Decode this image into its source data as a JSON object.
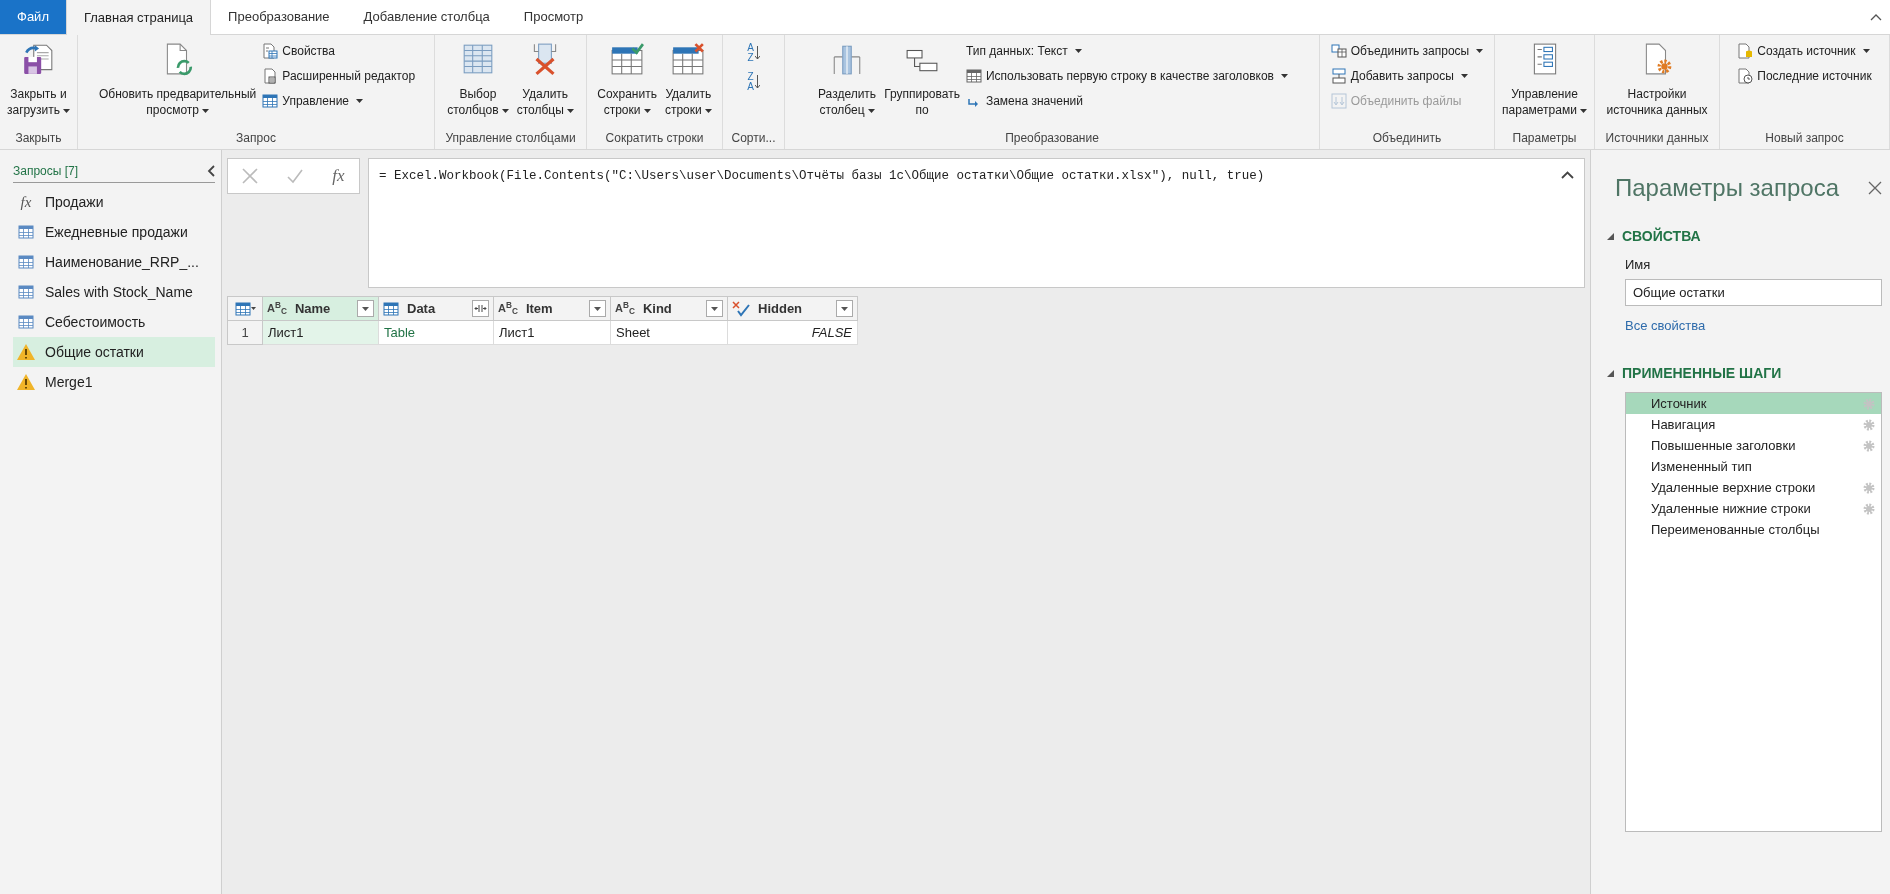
{
  "tabs": [
    {
      "label": "Файл",
      "kind": "file",
      "selected": false
    },
    {
      "label": "Главная страница",
      "kind": "tab",
      "selected": true
    },
    {
      "label": "Преобразование",
      "kind": "tab",
      "selected": false
    },
    {
      "label": "Добавление столбца",
      "kind": "tab",
      "selected": false
    },
    {
      "label": "Просмотр",
      "kind": "tab",
      "selected": false
    }
  ],
  "ribbon": {
    "groups": [
      {
        "label": "Закрыть",
        "items": [
          {
            "kind": "large",
            "lines": [
              "Закрыть и",
              "загрузить"
            ],
            "dropdown": true
          }
        ]
      },
      {
        "label": "Запрос",
        "items": [
          {
            "kind": "large",
            "lines": [
              "Обновить предварительный",
              "просмотр"
            ],
            "dropdown": true
          },
          {
            "kind": "small",
            "label": "Свойства",
            "dropdown": false,
            "disabled": false
          },
          {
            "kind": "small",
            "label": "Расширенный редактор",
            "dropdown": false,
            "disabled": false
          },
          {
            "kind": "small",
            "label": "Управление",
            "dropdown": true,
            "disabled": false
          }
        ]
      },
      {
        "label": "Управление столбцами",
        "items": [
          {
            "kind": "large",
            "lines": [
              "Выбор",
              "столбцов"
            ],
            "dropdown": true
          },
          {
            "kind": "large",
            "lines": [
              "Удалить",
              "столбцы"
            ],
            "dropdown": true
          }
        ]
      },
      {
        "label": "Сократить строки",
        "items": [
          {
            "kind": "large",
            "lines": [
              "Сохранить",
              "строки"
            ],
            "dropdown": true
          },
          {
            "kind": "large",
            "lines": [
              "Удалить",
              "строки"
            ],
            "dropdown": true
          }
        ]
      },
      {
        "label": "Сорти...",
        "items": [
          {
            "kind": "glyph",
            "glyph": [
              "A",
              "Z"
            ]
          },
          {
            "kind": "glyph",
            "glyph": [
              "Z",
              "A"
            ]
          }
        ]
      },
      {
        "label": "Преобразование",
        "items": [
          {
            "kind": "large",
            "lines": [
              "Разделить",
              "столбец"
            ],
            "dropdown": true
          },
          {
            "kind": "large",
            "lines": [
              "Группировать",
              "по"
            ],
            "dropdown": false
          },
          {
            "kind": "small",
            "label": "Тип данных: Текст",
            "dropdown": true,
            "disabled": false
          },
          {
            "kind": "small",
            "label": "Использовать первую строку в качестве заголовков",
            "dropdown": true,
            "disabled": false
          },
          {
            "kind": "small",
            "label": "Замена значений",
            "dropdown": false,
            "disabled": false
          }
        ]
      },
      {
        "label": "Объединить",
        "items": [
          {
            "kind": "small",
            "label": "Объединить запросы",
            "dropdown": true,
            "disabled": false
          },
          {
            "kind": "small",
            "label": "Добавить запросы",
            "dropdown": true,
            "disabled": false
          },
          {
            "kind": "small",
            "label": "Объединить файлы",
            "dropdown": false,
            "disabled": true
          }
        ]
      },
      {
        "label": "Параметры",
        "items": [
          {
            "kind": "large",
            "lines": [
              "Управление",
              "параметрами"
            ],
            "dropdown": true
          }
        ]
      },
      {
        "label": "Источники данных",
        "items": [
          {
            "kind": "large",
            "lines": [
              "Настройки",
              "источника данных"
            ],
            "dropdown": false
          }
        ]
      },
      {
        "label": "Новый запрос",
        "items": [
          {
            "kind": "small",
            "label": "Создать источник",
            "dropdown": true,
            "disabled": false
          },
          {
            "kind": "small",
            "label": "Последние источник",
            "dropdown": false,
            "disabled": false
          }
        ]
      }
    ]
  },
  "queries": {
    "title": "Запросы [7]",
    "items": [
      {
        "label": "Продажи",
        "kind": "function",
        "glyph": "fx",
        "selected": false
      },
      {
        "label": "Ежедневные продажи",
        "kind": "table",
        "selected": false
      },
      {
        "label": "Наименование_RRP_...",
        "kind": "table",
        "selected": false
      },
      {
        "label": "Sales with Stock_Name",
        "kind": "table",
        "selected": false
      },
      {
        "label": "Себестоимость",
        "kind": "table",
        "selected": false
      },
      {
        "label": "Общие остатки",
        "kind": "warning",
        "selected": true
      },
      {
        "label": "Merge1",
        "kind": "warning",
        "selected": false
      }
    ]
  },
  "formula_bar": {
    "fx": "fx",
    "formula": "= Excel.Workbook(File.Contents(\"C:\\Users\\user\\Documents\\Отчёты базы 1с\\Общие остатки\\Общие остатки.xlsx\"), null, true)"
  },
  "table": {
    "columns": [
      {
        "name": "Name",
        "kind": "text",
        "type_glyph": "A$^{B}$$_{C}$",
        "selected": true,
        "expandable": false
      },
      {
        "name": "Data",
        "kind": "table",
        "selected": false,
        "expandable": true
      },
      {
        "name": "Item",
        "kind": "text",
        "type_glyph": "A$^{B}$$_{C}$",
        "selected": false,
        "expandable": false
      },
      {
        "name": "Kind",
        "kind": "text",
        "type_glyph": "A$^{B}$$_{C}$",
        "selected": false,
        "expandable": false
      },
      {
        "name": "Hidden",
        "kind": "logical",
        "selected": false,
        "expandable": false
      }
    ],
    "rows": [
      {
        "number": "1",
        "cells": [
          "Лист1",
          "Table",
          "Лист1",
          "Sheet",
          "FALSE"
        ]
      }
    ]
  },
  "query_settings": {
    "title": "Параметры запроса",
    "properties": {
      "heading": "СВОЙСТВА",
      "expanded": true,
      "name_label": "Имя",
      "name_value": "Общие остатки",
      "all_properties_link": "Все свойства"
    },
    "steps": {
      "heading": "ПРИМЕНЕННЫЕ ШАГИ",
      "expanded": true,
      "items": [
        {
          "label": "Источник",
          "has_settings": true,
          "selected": true
        },
        {
          "label": "Навигация",
          "has_settings": true,
          "selected": false
        },
        {
          "label": "Повышенные заголовки",
          "has_settings": true,
          "selected": false
        },
        {
          "label": "Измененный тип",
          "has_settings": false,
          "selected": false
        },
        {
          "label": "Удаленные верхние строки",
          "has_settings": true,
          "selected": false
        },
        {
          "label": "Удаленные нижние строки",
          "has_settings": true,
          "selected": false
        },
        {
          "label": "Переименованные столбцы",
          "has_settings": false,
          "selected": false
        }
      ]
    }
  }
}
